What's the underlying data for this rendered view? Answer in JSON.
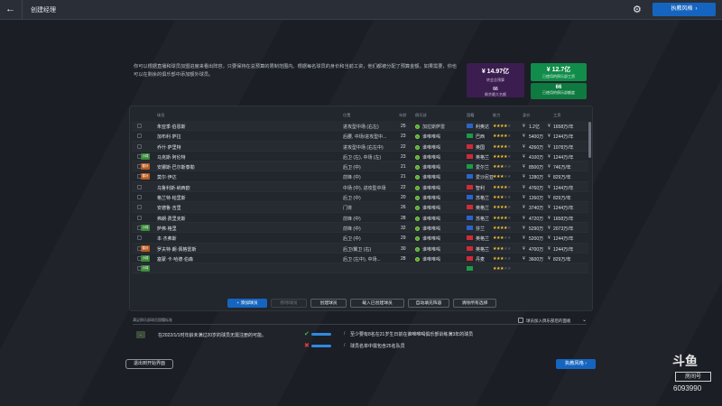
{
  "topbar": {
    "title": "创建经理",
    "continue": "执教风格",
    "continue_chev": "›"
  },
  "info": "你可以根据直播和球员加盟进度来看出阵容，只要保持在总预算的限制范围内。根据每名球员的身价和当前工资，他们都被分配了预算金额。如果需要，你也可以在剩余的俱乐部中添加额外球员。",
  "budgets": {
    "transfer": {
      "amount": "¥ 14.97亿",
      "label": "转会总预算",
      "sub": "66",
      "sub_label": "剩余最大名额"
    },
    "wage": {
      "amount": "¥ 12.7亿",
      "label": "已使用的俱乐部工资"
    },
    "wage2": {
      "amount": "66",
      "label": "已使用的俱乐部额度"
    }
  },
  "table": {
    "headers": [
      "球员",
      "位置",
      "年龄",
      "俱乐部",
      "国籍",
      "能力",
      "身价",
      "工资"
    ],
    "rows": [
      {
        "badge": "",
        "name": "朱亚季·伯恩斯",
        "pos": "进攻型中场 (右左)",
        "age": "25",
        "club": "加拉斯萨雷",
        "nat": "利奥达",
        "stars": 4,
        "val": "1.2亿",
        "wage": "1658万/年",
        "flag": "#2b64c6"
      },
      {
        "badge": "",
        "name": "加布利·萨拉",
        "pos": "后腰, 中场/进攻型中...",
        "age": "23",
        "club": "谁唯唯喝",
        "nat": "巴西",
        "stars": 4,
        "val": "5400万",
        "wage": "1244万/年",
        "flag": "#1a9b46"
      },
      {
        "badge": "",
        "name": "乔什·萨里特",
        "pos": "进攻型中场 (右左中)",
        "age": "22",
        "club": "谁唯唯喝",
        "nat": "英国",
        "stars": 4,
        "val": "4260万",
        "wage": "1078万/年",
        "flag": "#cf2b36"
      },
      {
        "badge": "小将",
        "name": "马克斯·阿伦特",
        "pos": "后卫 (左), 中场 (左)",
        "age": "23",
        "club": "谁唯唯喝",
        "nat": "英格兰",
        "stars": 4,
        "val": "4100万",
        "wage": "1244万/年",
        "flag": "#cf2b36"
      },
      {
        "badge": "替补",
        "name": "安娜斯·巴尔斯泰勒",
        "pos": "后卫 (中)",
        "age": "21",
        "club": "谁唯唯喝",
        "nat": "爱尔兰",
        "stars": 3,
        "val": "8500万",
        "wage": "746万/年",
        "flag": "#1a9b46"
      },
      {
        "badge": "替补",
        "name": "莫尔·伊达",
        "pos": "前锋 (中)",
        "age": "21",
        "club": "谁唯唯喝",
        "nat": "爱沙尼亚",
        "stars": 3,
        "val": "1280万",
        "wage": "829万/年",
        "flag": "#2b64c6"
      },
      {
        "badge": "",
        "name": "乌鲁利斯·纳西欧",
        "pos": "中场 (中), 进攻型中场",
        "age": "22",
        "club": "谁唯唯喝",
        "nat": "智利",
        "stars": 4,
        "val": "4760万",
        "wage": "1244万/年",
        "flag": "#cf2b36"
      },
      {
        "badge": "",
        "name": "格兰特·帕里斯",
        "pos": "后卫 (中)",
        "age": "20",
        "club": "谁唯唯喝",
        "nat": "苏格兰",
        "stars": 3,
        "val": "1260万",
        "wage": "829万/年",
        "flag": "#2b64c6"
      },
      {
        "badge": "",
        "name": "安德鲁·吉里",
        "pos": "门将",
        "age": "26",
        "club": "谁唯唯喝",
        "nat": "英格兰",
        "stars": 4,
        "val": "3740万",
        "wage": "1244万/年",
        "flag": "#cf2b36"
      },
      {
        "badge": "",
        "name": "弗朗·费里克斯",
        "pos": "前锋 (中)",
        "age": "28",
        "club": "谁唯唯喝",
        "nat": "苏格兰",
        "stars": 4,
        "val": "4720万",
        "wage": "1658万/年",
        "flag": "#2b64c6"
      },
      {
        "badge": "小将",
        "name": "萨弗·格里",
        "pos": "前锋 (中)",
        "age": "32",
        "club": "谁唯唯喝",
        "nat": "芬兰",
        "stars": 4,
        "val": "5290万",
        "wage": "2073万/年",
        "flag": "#2b64c6"
      },
      {
        "badge": "",
        "name": "本·杰弗斯",
        "pos": "后卫 (中)",
        "age": "29",
        "club": "谁唯唯喝",
        "nat": "英格兰",
        "stars": 3,
        "val": "5200万",
        "wage": "1244万/年",
        "flag": "#cf2b36"
      },
      {
        "badge": "替补",
        "name": "罗夫特·朗·佩格雷斯",
        "pos": "后卫/翼卫 (右)",
        "age": "30",
        "club": "谁唯唯喝",
        "nat": "英格兰",
        "stars": 3,
        "val": "4700万",
        "wage": "1244万/年",
        "flag": "#cf2b36"
      },
      {
        "badge": "小将",
        "name": "塞蒙·卡·哈德·伯森",
        "pos": "后卫 (左中), 中场...",
        "age": "28",
        "club": "谁唯唯喝",
        "nat": "丹麦",
        "stars": 3,
        "val": "3600万",
        "wage": "829万/年",
        "flag": "#cf2b36"
      },
      {
        "badge": "小将",
        "name": "",
        "pos": "",
        "age": "",
        "club": "",
        "nat": "",
        "stars": 3,
        "val": "",
        "wage": "",
        "flag": "#1a9b46"
      }
    ]
  },
  "actions": {
    "add": "+ 添加球员",
    "remove": "移除球员",
    "create": "创建球员",
    "load": "载入已创建球员",
    "autofill": "自动填充阵容",
    "clear": "清除所有选择"
  },
  "requirements": {
    "header": "满足俱乐部球员国籍标准",
    "toggle": "球员加入俱乐部后的面板",
    "icon": "←",
    "note": "在2022/1/1时年龄未满过20岁的球员无需注册的可能。",
    "cond1": "至少要有8名在21岁生日前在谁唯唯喝俱乐部训练满3年的球员",
    "cond2": "球员名单中需包含25名队员",
    "ok_mark": "✔",
    "no_mark": "✖",
    "slash": "/"
  },
  "footer": {
    "exit": "退出到开始界面",
    "continue": "执教风格 ›"
  },
  "watermark": {
    "logo": "斗鱼",
    "room_label": "房间号",
    "room": "6093990"
  },
  "colors": {
    "accent": "#1565c0",
    "transfer": "#3b1e4f",
    "wage": "#128c4a",
    "star": "#f4c430"
  }
}
